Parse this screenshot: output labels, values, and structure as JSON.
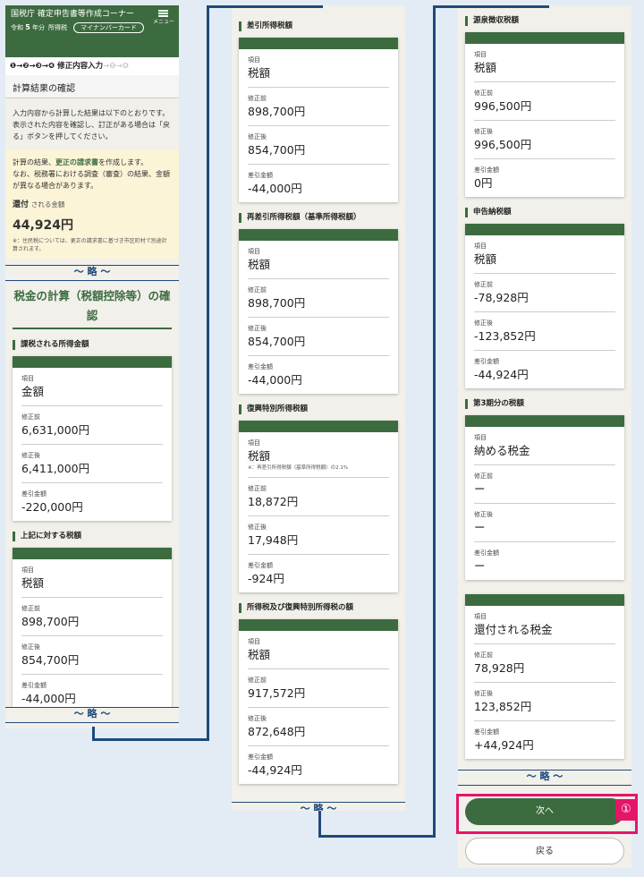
{
  "header": {
    "title": "国税庁 確定申告書等作成コーナー",
    "year_prefix": "令和",
    "year_number": "5",
    "year_suffix": "年分",
    "tax_type": "所得税",
    "card_pill": "マイナンバーカード",
    "menu_label": "メニュー"
  },
  "steps": {
    "active": "❶→❷→❸→❹ 修正内容入力",
    "inactive": "→❺→❻"
  },
  "page_title": "計算結果の確認",
  "intro": "入力内容から計算した結果は以下のとおりです。\n表示された内容を確認し、訂正がある場合は「戻る」ボタンを押してください。",
  "notice": {
    "line1_pre": "計算の結果、",
    "line1_highlight": "更正の請求書",
    "line1_post": "を作成します。",
    "line2": "なお、税務署における調査（審査）の結果、金額が異なる場合があります。",
    "refund_bold": "還付",
    "refund_small": "される金額",
    "refund_amount": "44,924円",
    "footnote": "※：住民税については、更正の請求書に基づき市区町村で別途計算されます。"
  },
  "break_label": "～ 略 ～",
  "section_title": "税金の計算（税額控除等）の確認",
  "labels": {
    "item": "項目",
    "before": "修正前",
    "after": "修正後",
    "diff": "差引金額"
  },
  "cards": [
    {
      "heading": "課税される所得金額",
      "item": "金額",
      "before": "6,631,000円",
      "after": "6,411,000円",
      "diff": "-220,000円"
    },
    {
      "heading": "上記に対する税額",
      "item": "税額",
      "before": "898,700円",
      "after": "854,700円",
      "diff": "-44,000円"
    },
    {
      "heading": "差引所得税額",
      "item": "税額",
      "before": "898,700円",
      "after": "854,700円",
      "diff": "-44,000円"
    },
    {
      "heading": "再差引所得税額（基準所得税額）",
      "item": "税額",
      "before": "898,700円",
      "after": "854,700円",
      "diff": "-44,000円"
    },
    {
      "heading": "復興特別所得税額",
      "item": "税額",
      "note": "※：再差引所得税額（基準所得税額）の2.1%",
      "before": "18,872円",
      "after": "17,948円",
      "diff": "-924円"
    },
    {
      "heading": "所得税及び復興特別所得税の額",
      "item": "税額",
      "before": "917,572円",
      "after": "872,648円",
      "diff": "-44,924円"
    },
    {
      "heading": "源泉徴収税額",
      "item": "税額",
      "before": "996,500円",
      "after": "996,500円",
      "diff": "0円"
    },
    {
      "heading": "申告納税額",
      "item": "税額",
      "before": "-78,928円",
      "after": "-123,852円",
      "diff": "-44,924円"
    },
    {
      "heading": "第3期分の税額",
      "item": "納める税金",
      "before": "ー",
      "after": "ー",
      "diff": "ー"
    },
    {
      "heading": "",
      "item": "還付される税金",
      "before": "78,928円",
      "after": "123,852円",
      "diff": "+44,924円"
    }
  ],
  "buttons": {
    "next": "次へ",
    "back": "戻る"
  },
  "callout_number": "①",
  "colors": {
    "brand_green": "#3c6b3f",
    "highlight_pink": "#e5156a",
    "connector_blue": "#1f4a7a",
    "notice_bg": "#fbf4d7"
  }
}
